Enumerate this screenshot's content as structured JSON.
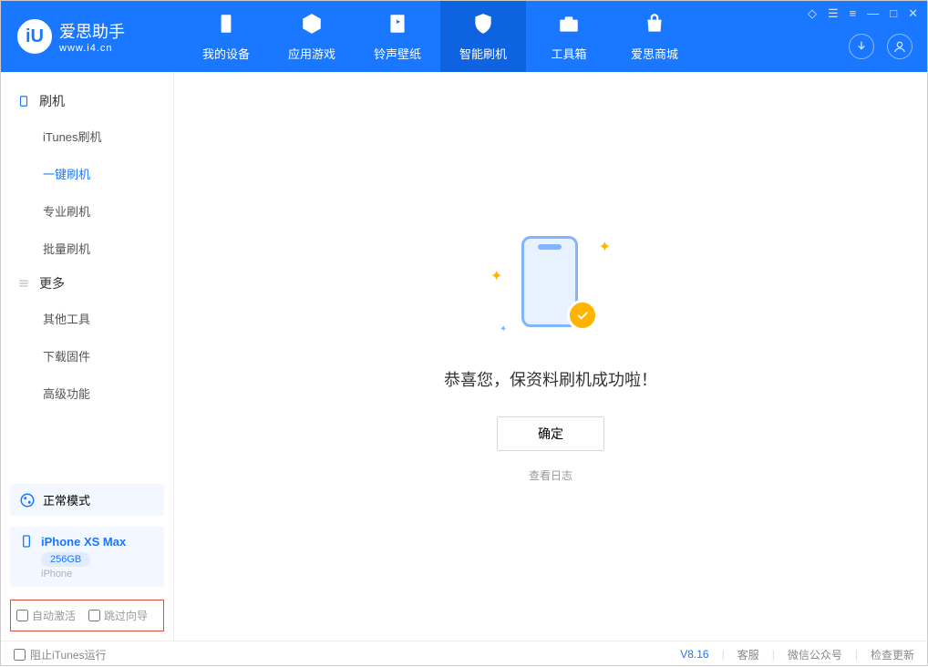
{
  "brand": {
    "title": "爱思助手",
    "url": "www.i4.cn",
    "logo_letter": "iU"
  },
  "nav": [
    {
      "label": "我的设备"
    },
    {
      "label": "应用游戏"
    },
    {
      "label": "铃声壁纸"
    },
    {
      "label": "智能刷机"
    },
    {
      "label": "工具箱"
    },
    {
      "label": "爱思商城"
    }
  ],
  "sidebar": {
    "section1_title": "刷机",
    "section1_items": [
      "iTunes刷机",
      "一键刷机",
      "专业刷机",
      "批量刷机"
    ],
    "section2_title": "更多",
    "section2_items": [
      "其他工具",
      "下载固件",
      "高级功能"
    ]
  },
  "mode": {
    "label": "正常模式"
  },
  "device": {
    "name": "iPhone XS Max",
    "storage": "256GB",
    "type": "iPhone"
  },
  "checks": {
    "auto_activate": "自动激活",
    "skip_guide": "跳过向导"
  },
  "main": {
    "message": "恭喜您，保资料刷机成功啦！",
    "ok": "确定",
    "view_log": "查看日志"
  },
  "footer": {
    "block_itunes": "阻止iTunes运行",
    "version": "V8.16",
    "links": [
      "客服",
      "微信公众号",
      "检查更新"
    ]
  }
}
